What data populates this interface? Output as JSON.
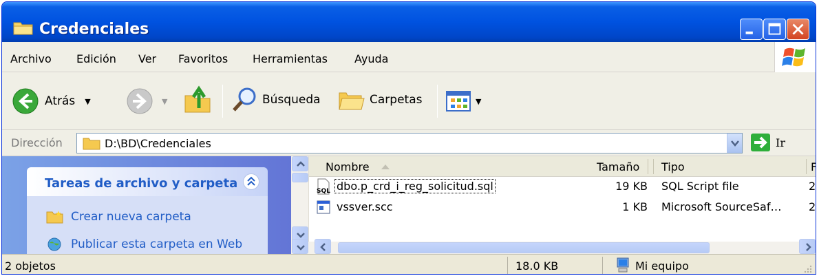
{
  "window": {
    "title": "Credenciales",
    "title_icon": "folder-icon",
    "controls": [
      "minimize-icon",
      "maximize-icon",
      "close-icon"
    ]
  },
  "menubar": {
    "items": [
      "Archivo",
      "Edición",
      "Ver",
      "Favoritos",
      "Herramientas",
      "Ayuda"
    ],
    "logo": "windows-logo"
  },
  "toolbar": {
    "back_label": "Atrás",
    "search_label": "Búsqueda",
    "folders_label": "Carpetas",
    "icons": [
      "back-icon",
      "forward-icon",
      "up-folder-icon",
      "search-icon",
      "folders-icon",
      "views-icon"
    ]
  },
  "address": {
    "label": "Dirección",
    "path": "D:\\BD\\Credenciales",
    "go_label": "Ir"
  },
  "tasks": {
    "title": "Tareas de archivo y carpeta",
    "links": [
      "Crear nueva carpeta",
      "Publicar esta carpeta en Web"
    ]
  },
  "files": {
    "columns": [
      "Nombre",
      "Tamaño",
      "Tipo",
      "F"
    ],
    "rows": [
      {
        "name": "dbo.p_crd_i_reg_solicitud.sql",
        "size": "19 KB",
        "type": "SQL Script file",
        "date": "2"
      },
      {
        "name": "vssver.scc",
        "size": "1 KB",
        "type": "Microsoft SourceSaf…",
        "date": "2"
      }
    ]
  },
  "status": {
    "count": "2 objetos",
    "size": "18.0 KB",
    "location": "Mi equipo"
  },
  "colors": {
    "titlebar": "#0052e0",
    "taskpane": "#6375d6",
    "link": "#215dc6"
  }
}
